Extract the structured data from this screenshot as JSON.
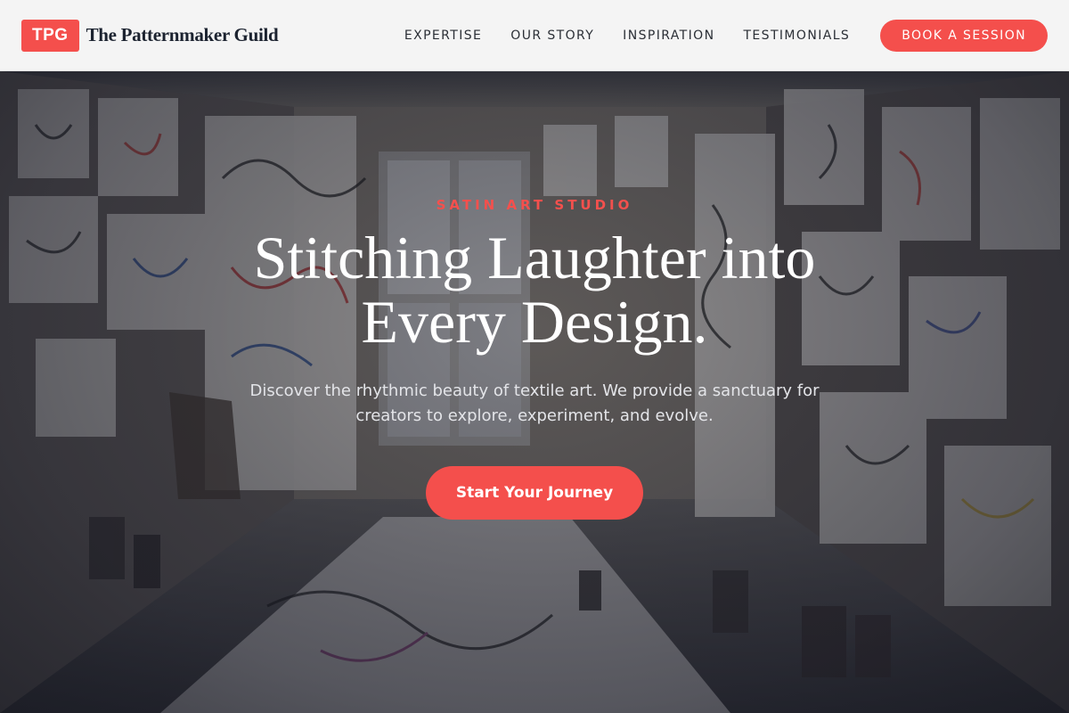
{
  "header": {
    "logo_badge": "TPG",
    "brand_name": "The Patternmaker Guild",
    "nav": [
      {
        "label": "EXPERTISE"
      },
      {
        "label": "OUR STORY"
      },
      {
        "label": "INSPIRATION"
      },
      {
        "label": "TESTIMONIALS"
      }
    ],
    "cta_label": "BOOK A SESSION"
  },
  "hero": {
    "eyebrow": "SATIN ART STUDIO",
    "headline": "Stitching Laughter into Every Design.",
    "subtext": "Discover the rhythmic beauty of textile art. We provide a sanctuary for creators to explore, experiment, and evolve.",
    "cta_label": "Start Your Journey",
    "background_image": "art-studio-room-photo"
  },
  "colors": {
    "accent": "#f44f4c",
    "header_bg": "#f4f4f4",
    "brand_text": "#1c2330",
    "hero_text": "#ffffff"
  }
}
